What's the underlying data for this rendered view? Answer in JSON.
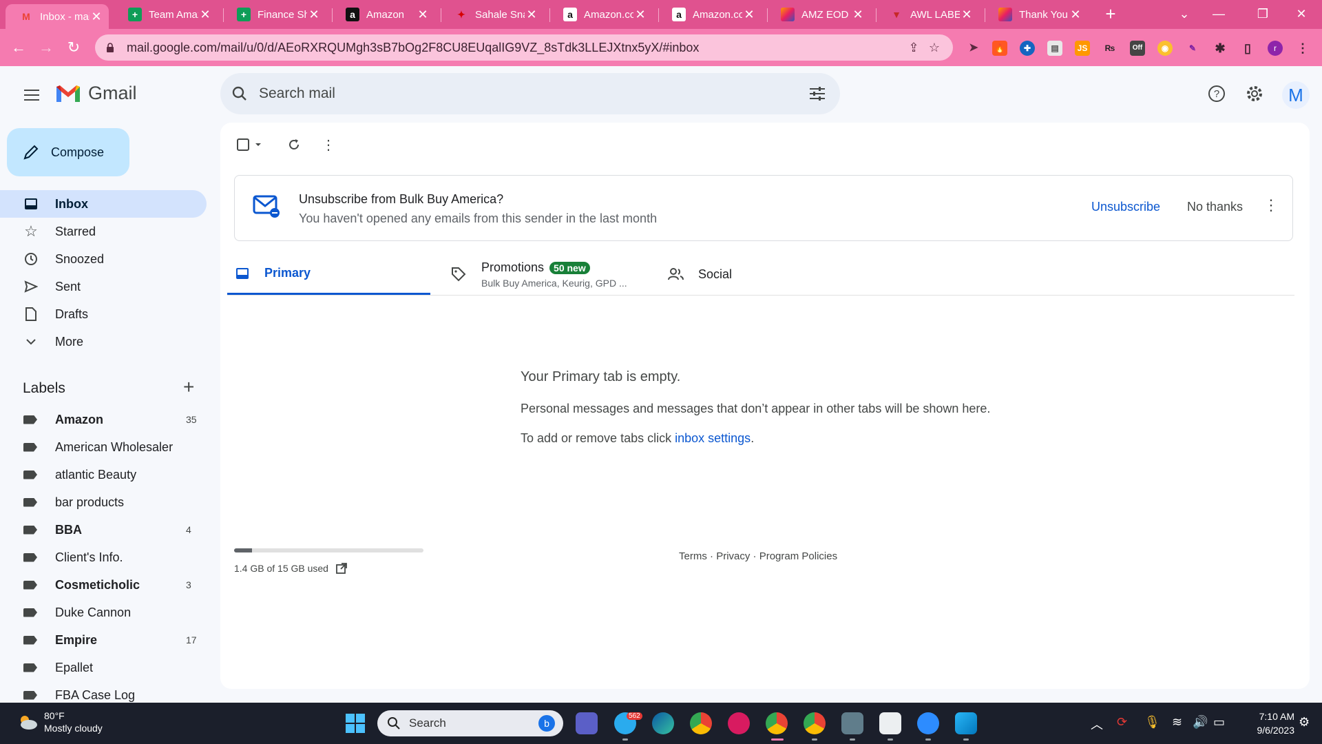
{
  "browser": {
    "tabs": [
      {
        "label": "Inbox - mail",
        "favicon": "gmail-icon",
        "active": true
      },
      {
        "label": "Team Amaz",
        "favicon": "sheets-icon"
      },
      {
        "label": "Finance She",
        "favicon": "sheets-icon"
      },
      {
        "label": "Amazon",
        "favicon": "amazon-icon"
      },
      {
        "label": "Sahale Snac",
        "favicon": "red-bird-icon"
      },
      {
        "label": "Amazon.cor",
        "favicon": "amazon-icon"
      },
      {
        "label": "Amazon.cor",
        "favicon": "amazon-icon"
      },
      {
        "label": "AMZ EOD F",
        "favicon": "colorful-pinwheel-icon"
      },
      {
        "label": "AWL LABEL",
        "favicon": "red-shield-icon"
      },
      {
        "label": "Thank You",
        "favicon": "colorful-pinwheel-icon"
      }
    ],
    "url": "mail.google.com/mail/u/0/d/AEoRXRQUMgh3sB7bOg2F8CU8EUqalIG9VZ_8sTdk3LLEJXtnx5yX/#inbox",
    "ext_off_badge": "Off",
    "profile_initial": "r",
    "colors": {
      "tab_strip": "#e0528f",
      "toolbar": "#f57bb0"
    }
  },
  "gmail": {
    "app_name": "Gmail",
    "search_placeholder": "Search mail",
    "account_initial": "M",
    "compose_label": "Compose",
    "nav": [
      {
        "label": "Inbox",
        "icon": "inbox-icon",
        "active": true
      },
      {
        "label": "Starred",
        "icon": "star-icon"
      },
      {
        "label": "Snoozed",
        "icon": "clock-icon"
      },
      {
        "label": "Sent",
        "icon": "send-icon"
      },
      {
        "label": "Drafts",
        "icon": "draft-icon"
      },
      {
        "label": "More",
        "icon": "chevron-down-icon"
      }
    ],
    "labels_heading": "Labels",
    "labels": [
      {
        "name": "Amazon",
        "count": "35",
        "bold": true
      },
      {
        "name": "American Wholesaler",
        "count": ""
      },
      {
        "name": "atlantic Beauty",
        "count": ""
      },
      {
        "name": "bar products",
        "count": ""
      },
      {
        "name": "BBA",
        "count": "4",
        "bold": true
      },
      {
        "name": "Client's Info.",
        "count": ""
      },
      {
        "name": "Cosmeticholic",
        "count": "3",
        "bold": true
      },
      {
        "name": "Duke Cannon",
        "count": ""
      },
      {
        "name": "Empire",
        "count": "17",
        "bold": true
      },
      {
        "name": "Epallet",
        "count": ""
      },
      {
        "name": "FBA Case Log",
        "count": ""
      }
    ],
    "unsubscribe_banner": {
      "title": "Unsubscribe from Bulk Buy America?",
      "subtitle": "You haven't opened any emails from this sender in the last month",
      "unsubscribe_label": "Unsubscribe",
      "no_thanks_label": "No thanks"
    },
    "category_tabs": {
      "primary": "Primary",
      "promotions": "Promotions",
      "promotions_badge": "50 new",
      "promotions_snippet": "Bulk Buy America, Keurig, GPD ...",
      "social": "Social"
    },
    "empty_state": {
      "title": "Your Primary tab is empty.",
      "body": "Personal messages and messages that don’t appear in other tabs will be shown here.",
      "settings_prefix": "To add or remove tabs click ",
      "settings_link": "inbox settings",
      "settings_suffix": "."
    },
    "storage": {
      "text": "1.4 GB of 15 GB used",
      "used_fraction": 0.093
    },
    "footer": {
      "terms": "Terms",
      "privacy": "Privacy",
      "policies": "Program Policies",
      "sep": "·"
    }
  },
  "taskbar": {
    "temperature": "80°F",
    "weather": "Mostly cloudy",
    "search_label": "Search",
    "telegram_badge": "562",
    "time": "7:10 AM",
    "date": "9/6/2023"
  }
}
